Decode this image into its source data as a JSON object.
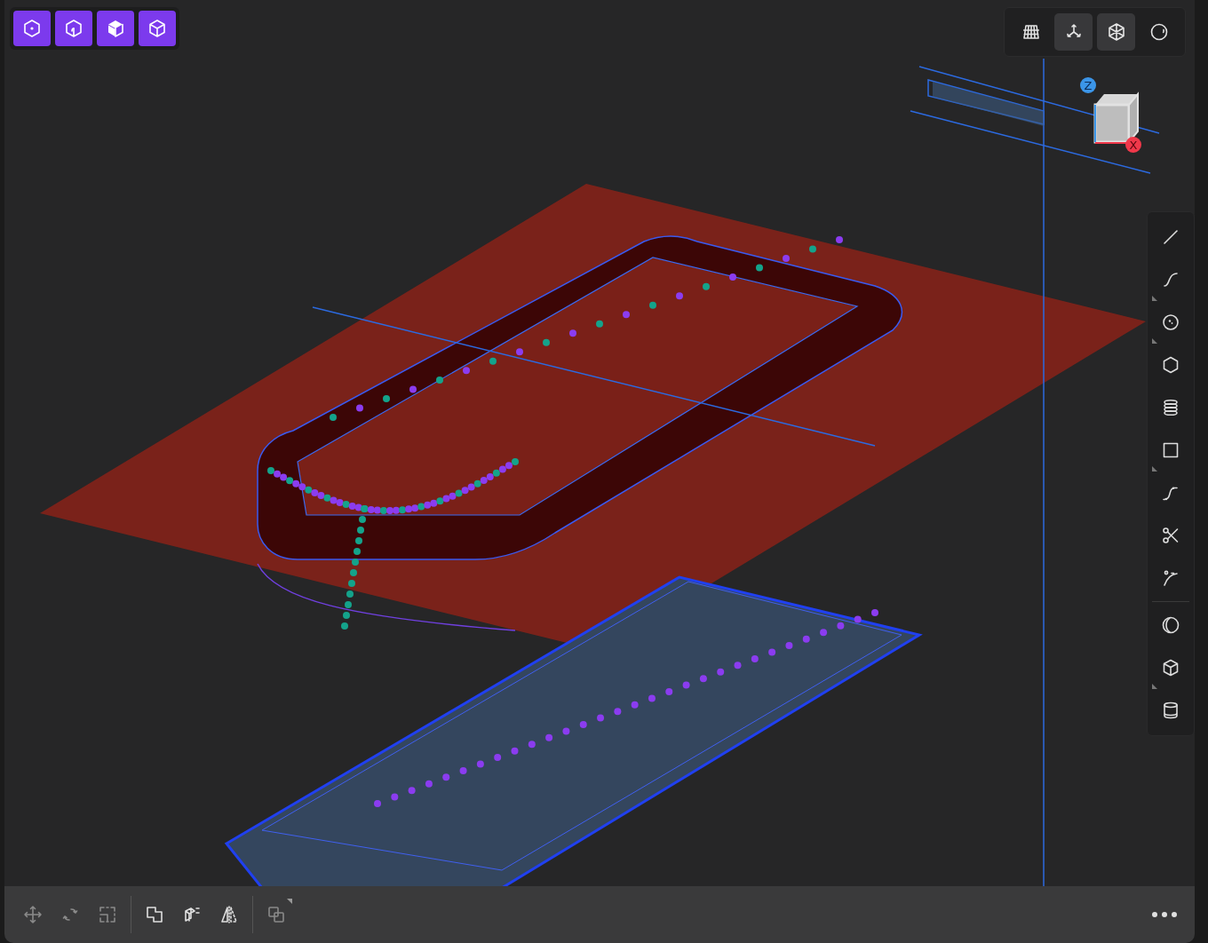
{
  "view_toolbar": {
    "buttons": [
      {
        "kind": "top",
        "on": true
      },
      {
        "kind": "front",
        "on": true
      },
      {
        "kind": "iso-solid",
        "on": true
      },
      {
        "kind": "iso-wire",
        "on": true
      }
    ]
  },
  "display_toolbar": {
    "buttons": [
      {
        "kind": "grid",
        "on": false
      },
      {
        "kind": "axes",
        "on": true
      },
      {
        "kind": "wireframe",
        "on": true
      },
      {
        "kind": "sphere",
        "on": false
      }
    ]
  },
  "view_cube": {
    "axes": [
      {
        "label": "Z",
        "kind": "z"
      },
      {
        "label": "X",
        "kind": "x"
      }
    ]
  },
  "tool_palette": {
    "groups": [
      [
        {
          "kind": "line",
          "has_submenu": false
        },
        {
          "kind": "spline",
          "has_submenu": true
        },
        {
          "kind": "circle",
          "has_submenu": true
        },
        {
          "kind": "polygon",
          "has_submenu": false
        },
        {
          "kind": "helix",
          "has_submenu": false
        },
        {
          "kind": "rectangle",
          "has_submenu": true
        },
        {
          "kind": "point-curve",
          "has_submenu": false
        },
        {
          "kind": "scissors",
          "has_submenu": false
        },
        {
          "kind": "fillet",
          "has_submenu": false
        }
      ],
      [
        {
          "kind": "shell",
          "has_submenu": false
        },
        {
          "kind": "box",
          "has_submenu": true
        },
        {
          "kind": "cylinder",
          "has_submenu": false
        }
      ]
    ]
  },
  "transform_bar": {
    "groups": [
      [
        {
          "kind": "move",
          "disabled": true,
          "has_submenu": false
        },
        {
          "kind": "rotate",
          "disabled": true,
          "has_submenu": false
        },
        {
          "kind": "scale",
          "disabled": true,
          "has_submenu": false
        }
      ],
      [
        {
          "kind": "union",
          "disabled": false,
          "has_submenu": false
        },
        {
          "kind": "extrude",
          "disabled": false,
          "has_submenu": false
        },
        {
          "kind": "mirror",
          "disabled": false,
          "has_submenu": false
        }
      ],
      [
        {
          "kind": "copy",
          "disabled": true,
          "has_submenu": true
        }
      ]
    ]
  }
}
